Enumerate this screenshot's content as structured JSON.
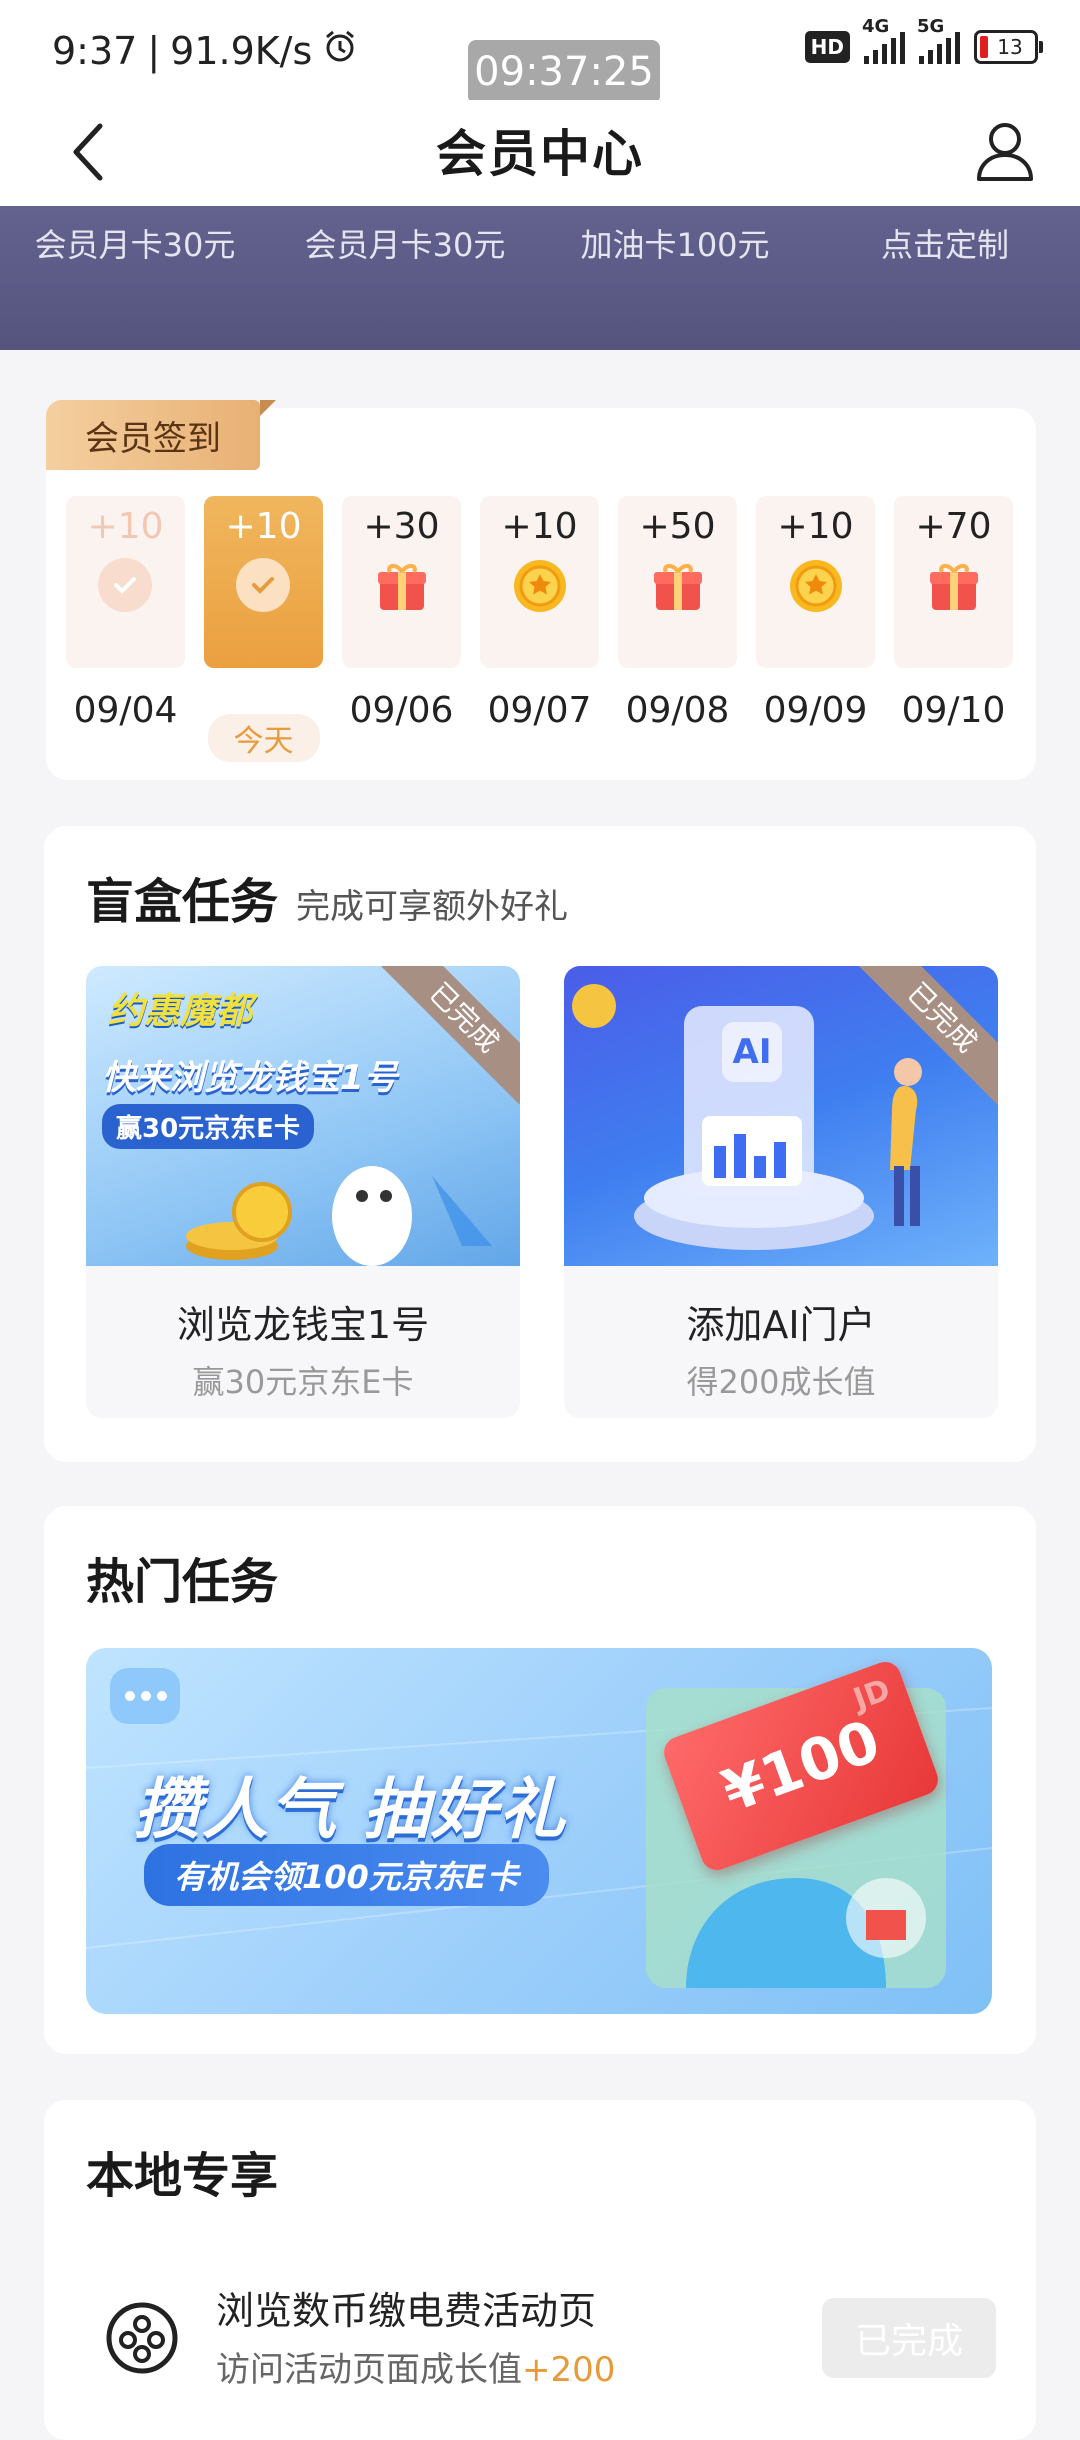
{
  "status_bar": {
    "time": "9:37",
    "network_speed": "91.9K/s",
    "center_clock": "09:37:25",
    "hd_badge": "HD",
    "sim1_net": "4G",
    "sim2_net": "5G",
    "battery": "13"
  },
  "header": {
    "title": "会员中心",
    "back_icon": "chevron-left-icon",
    "user_icon": "user-icon"
  },
  "benefits": [
    {
      "desc": "会员月卡30元"
    },
    {
      "desc": "会员月卡30元"
    },
    {
      "desc": "加油卡100元"
    },
    {
      "desc": "点击定制"
    }
  ],
  "signin": {
    "badge": "会员签到",
    "today_label": "今天",
    "days": [
      {
        "points": "+10",
        "date": "09/04",
        "state": "done",
        "icon": "check-icon"
      },
      {
        "points": "+10",
        "date": "今天",
        "state": "today",
        "icon": "check-icon"
      },
      {
        "points": "+30",
        "date": "09/06",
        "state": "pending",
        "icon": "gift-icon"
      },
      {
        "points": "+10",
        "date": "09/07",
        "state": "pending",
        "icon": "coin-icon"
      },
      {
        "points": "+50",
        "date": "09/08",
        "state": "pending",
        "icon": "gift-icon"
      },
      {
        "points": "+10",
        "date": "09/09",
        "state": "pending",
        "icon": "coin-icon"
      },
      {
        "points": "+70",
        "date": "09/10",
        "state": "pending",
        "icon": "gift-icon"
      }
    ]
  },
  "blind_box": {
    "title": "盲盒任务",
    "subtitle": "完成可享额外好礼",
    "items": [
      {
        "ribbon": "已完成",
        "name": "浏览龙钱宝1号",
        "desc": "赢30元京东E卡",
        "image_text": {
          "tag": "约惠魔都",
          "headline": "快来浏览龙钱宝1号",
          "sub": "赢30元京东E卡"
        }
      },
      {
        "ribbon": "已完成",
        "name": "添加AI门户",
        "desc": "得200成长值",
        "image_text": {
          "ai": "AI"
        }
      }
    ]
  },
  "hot_tasks": {
    "title": "热门任务",
    "banner": {
      "headline": "攒人气 抽好礼",
      "sub": "有机会领100元京东E卡",
      "card_value": "¥100",
      "card_brand": "JD"
    }
  },
  "local": {
    "title": "本地专享",
    "items": [
      {
        "name": "浏览数币缴电费活动页",
        "desc": "访问活动页面成长值",
        "reward": "+200",
        "button": "已完成",
        "icon": "film-reel-icon"
      }
    ]
  },
  "colors": {
    "banner_purple": "#5f5e8b",
    "today_orange": "#eea54a",
    "accent_orange": "#e89a3a",
    "gift_red": "#f2524c",
    "coin_gold": "#f8b820"
  }
}
